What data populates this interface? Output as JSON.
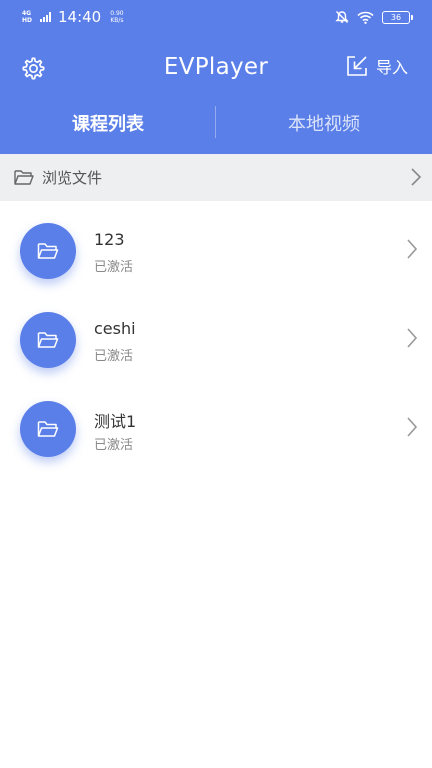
{
  "status_bar": {
    "network": "4G HD",
    "time": "14:40",
    "speed_value": "0.90",
    "speed_unit": "KB/s",
    "battery": "36"
  },
  "header": {
    "title": "EVPlayer",
    "import_label": "导入"
  },
  "tabs": [
    {
      "label": "课程列表",
      "active": true
    },
    {
      "label": "本地视频",
      "active": false
    }
  ],
  "browse": {
    "label": "浏览文件"
  },
  "items": [
    {
      "name": "123",
      "status": "已激活"
    },
    {
      "name": "ceshi",
      "status": "已激活"
    },
    {
      "name": "测试1",
      "status": "已激活"
    }
  ],
  "colors": {
    "accent": "#5b7fe8",
    "browse_bg": "#eeeff1",
    "text_primary": "#333333",
    "text_secondary": "#8a8a8a"
  },
  "icons": [
    "gear-icon",
    "import-icon",
    "folder-icon",
    "chevron-right-icon",
    "mute-icon",
    "wifi-icon",
    "battery-icon"
  ]
}
